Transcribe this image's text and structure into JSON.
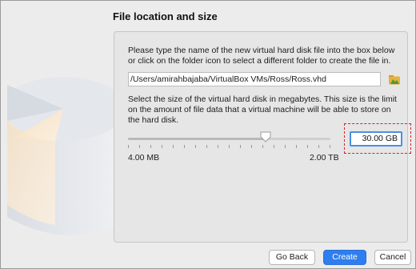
{
  "section_title": "File location and size",
  "location_description": "Please type the name of the new virtual hard disk file into the box below or click on the folder icon to select a different folder to create the file in.",
  "file_path": "/Users/amirahbajaba/VirtualBox VMs/Ross/Ross.vhd",
  "size_description": "Select the size of the virtual hard disk in megabytes. This size is the limit on the amount of file data that a virtual machine will be able to store on the hard disk.",
  "slider": {
    "min_label": "4.00 MB",
    "max_label": "2.00 TB",
    "position_fraction": 0.68
  },
  "size_value": "30.00 GB",
  "buttons": {
    "back": "Go Back",
    "create": "Create",
    "cancel": "Cancel"
  },
  "colors": {
    "accent": "#2f7ef0",
    "highlight": "#d2232a"
  },
  "icons": {
    "folder": "folder-icon"
  }
}
